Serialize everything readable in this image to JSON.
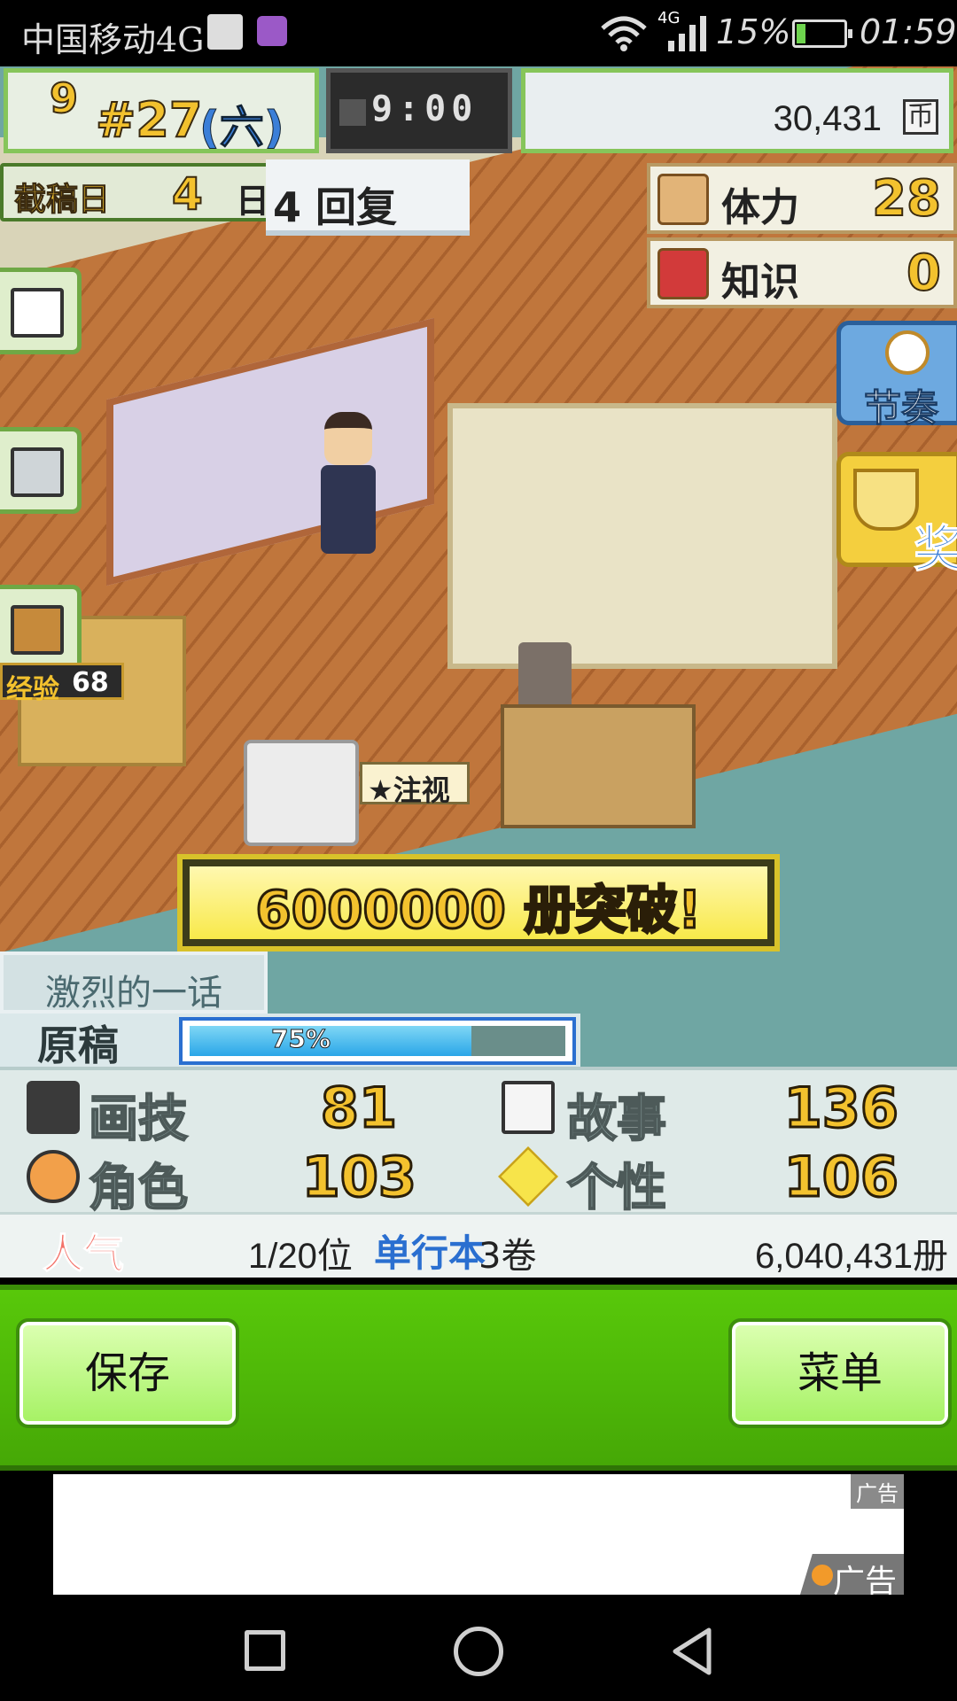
{
  "status_bar": {
    "carrier": "中国移动4G",
    "network": "4G",
    "battery": "15%",
    "time": "01:59"
  },
  "hud": {
    "week": "9",
    "week_number": "#27",
    "weekday": "(六)",
    "clock": "9:00",
    "money": "30,431",
    "money_icon": "币"
  },
  "deadline": {
    "label": "截稿日",
    "days": "4",
    "unit": "日"
  },
  "event_banner": "4 回复",
  "stats_top": {
    "stamina_label": "体力",
    "stamina": "28",
    "knowledge_label": "知识",
    "knowledge": "0"
  },
  "side_buttons": {
    "experience_label": "经验",
    "experience": "68"
  },
  "right_buttons": {
    "rhythm": "节奏",
    "award": "奖"
  },
  "scene": {
    "favorite_tag": "★注视",
    "breakthrough": "6000000 册突破!"
  },
  "manuscript": {
    "episode_title": "激烈的一话",
    "label": "原稿",
    "progress_text": "75%",
    "progress": 0.75
  },
  "stats": {
    "drawing_label": "画技",
    "drawing": "81",
    "story_label": "故事",
    "story": "136",
    "character_label": "角色",
    "character": "103",
    "personality_label": "个性",
    "personality": "106",
    "popularity_label": "人气",
    "rank": "1/20位",
    "volumes_label": "单行本",
    "volumes": "3卷",
    "sales": "6,040,431册"
  },
  "actions": {
    "save": "保存",
    "menu": "菜单"
  },
  "ad": {
    "tag": "广告",
    "tag2": "广告"
  },
  "colors": {
    "accent_green": "#58c80a",
    "gold": "#f3c22e",
    "blue": "#2a6fd0"
  }
}
